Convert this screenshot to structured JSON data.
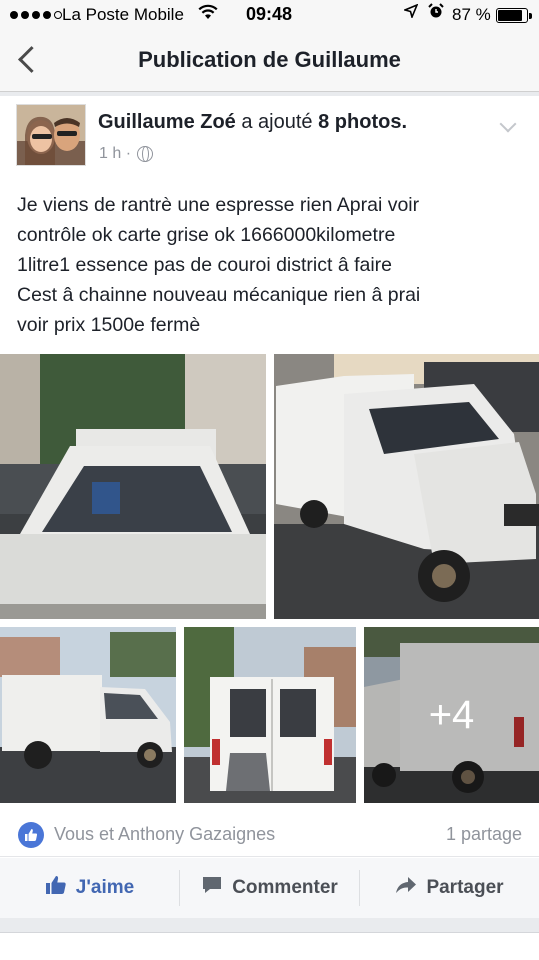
{
  "status_bar": {
    "carrier": "La Poste Mobile",
    "time": "09:48",
    "battery": "87 %",
    "battery_level": 0.87,
    "icons": [
      "signal-dots-icon",
      "wifi-icon",
      "location-arrow-icon",
      "alarm-clock-icon",
      "battery-icon"
    ]
  },
  "nav": {
    "title": "Publication de Guillaume",
    "back_icon": "chevron-left-icon"
  },
  "post": {
    "author": "Guillaume Zoé",
    "action_prefix": "a ajouté",
    "action_object": "8 photos.",
    "time": "1 h ·",
    "privacy_icon": "globe-icon",
    "body_lines": [
      "Je viens de rantrè une espresse rien Aprai voir",
      "contrôle ok carte grise ok 1666000kilometre",
      "1litre1 essence pas de couroi district â faire",
      "Cest â chainne nouveau mécanique rien â prai",
      "voir prix 1500e fermè"
    ],
    "more_photos": "+4"
  },
  "reactions": {
    "likers": "Vous et Anthony Gazaignes",
    "shares": "1 partage",
    "badge_icon": "thumbs-up-icon"
  },
  "actions": {
    "like": "J'aime",
    "comment": "Commenter",
    "share": "Partager"
  },
  "colors": {
    "facebook_blue": "#4267b2",
    "like_badge": "#4a76d7",
    "meta_gray": "#90949c"
  }
}
